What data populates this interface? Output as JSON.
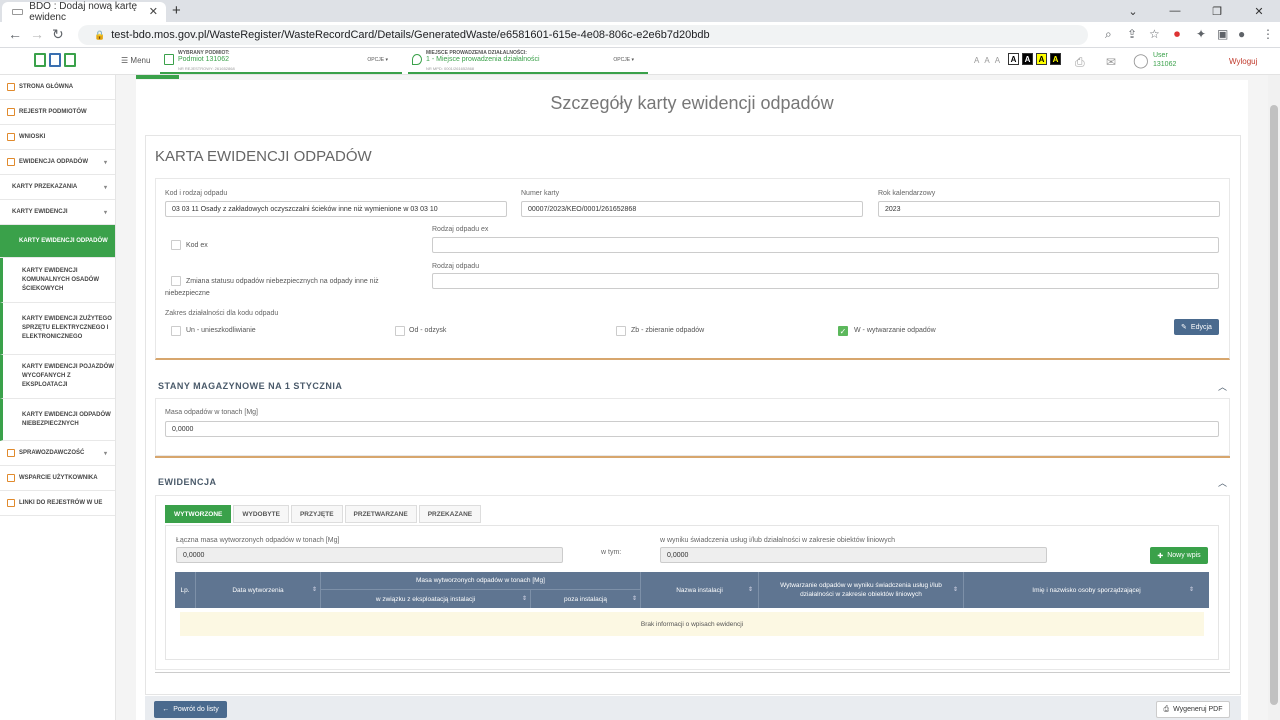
{
  "browser": {
    "tab_title": "BDO : Dodaj nową kartę ewidenc",
    "url": "test-bdo.mos.gov.pl/WasteRegister/WasteRecordCard/Details/GeneratedWaste/e6581601-615e-4e08-806c-e2e6b7d20bdb"
  },
  "header": {
    "menu_label": "Menu",
    "ctx1_label": "WYBRANY PODMIOT:",
    "ctx1_value": "Podmiot 131062",
    "ctx1_sub": "NR REJESTROWY: 261652868",
    "ctx1_opt": "OPCJE",
    "ctx2_label": "MIEJSCE PROWADZENIA DZIAŁALNOŚCI:",
    "ctx2_value": "1 - Miejsce prowadzenia działalności",
    "ctx2_sub": "NR MPD: 0001/261652868",
    "ctx2_opt": "OPCJE",
    "font_sizes": [
      "A",
      "A",
      "A"
    ],
    "contrast": [
      "A",
      "A",
      "A",
      "A"
    ],
    "user_line1": "User",
    "user_line2": "131062",
    "logout": "Wyloguj"
  },
  "sidebar": {
    "items": [
      {
        "label": "STRONA GŁÓWNA"
      },
      {
        "label": "REJESTR PODMIOTÓW"
      },
      {
        "label": "WNIOSKI"
      },
      {
        "label": "EWIDENCJA ODPADÓW"
      },
      {
        "label": "KARTY PRZEKAZANIA"
      },
      {
        "label": "KARTY EWIDENCJI"
      },
      {
        "label": "KARTY EWIDENCJI ODPADÓW"
      },
      {
        "label": "KARTY EWIDENCJI KOMUNALNYCH OSADÓW ŚCIEKOWYCH"
      },
      {
        "label": "KARTY EWIDENCJI ZUŻYTEGO SPRZĘTU ELEKTRYCZNEGO I ELEKTRONICZNEGO"
      },
      {
        "label": "KARTY EWIDENCJI POJAZDÓW WYCOFANYCH Z EKSPLOATACJI"
      },
      {
        "label": "KARTY EWIDENCJI ODPADÓW NIEBEZPIECZNYCH"
      },
      {
        "label": "SPRAWOZDAWCZOŚĆ"
      },
      {
        "label": "WSPARCIE UŻYTKOWNIKA"
      },
      {
        "label": "LINKI DO REJESTRÓW W UE"
      }
    ]
  },
  "main": {
    "page_title": "Szczegóły karty ewidencji odpadów",
    "card_title": "KARTA EWIDENCJI ODPADÓW",
    "waste_code_label": "Kod i rodzaj odpadu",
    "waste_code_value": "03 03 11 Osady z zakładowych oczyszczalni ścieków inne niż wymienione w 03 03 10",
    "card_number_label": "Numer karty",
    "card_number_value": "00007/2023/KEO/0001/261652868",
    "year_label": "Rok kalendarzowy",
    "year_value": "2023",
    "kod_ex_label": "Kod ex",
    "rodzaj_ex_label": "Rodzaj odpadu ex",
    "status_change_label_1": "Zmiana statusu odpadów niebezpiecznych na odpady inne niż",
    "status_change_label_2": "niebezpieczne",
    "rodzaj_label": "Rodzaj odpadu",
    "scope_label": "Zakres działalności dla kodu odpadu",
    "scope": [
      {
        "label": "Un - unieszkodliwianie",
        "checked": false
      },
      {
        "label": "Od - odzysk",
        "checked": false
      },
      {
        "label": "Zb - zbieranie odpadów",
        "checked": false
      },
      {
        "label": "W - wytwarzanie odpadów",
        "checked": true
      }
    ],
    "edit_button": "Edycja",
    "stock_header": "STANY MAGAZYNOWE NA 1 STYCZNIA",
    "stock_mass_label": "Masa odpadów w tonach [Mg]",
    "stock_mass_value": "0,0000",
    "ev_header": "EWIDENCJA",
    "tabs": [
      "WYTWORZONE",
      "WYDOBYTE",
      "PRZYJĘTE",
      "PRZETWARZANE",
      "PRZEKAZANE"
    ],
    "total_mass_label": "Łączna masa wytworzonych odpadów w tonach [Mg]",
    "total_mass_value": "0,0000",
    "wtym_label": "w tym:",
    "linear_label": "w wyniku świadczenia usług i/lub działalności w zakresie obiektów liniowych",
    "linear_value": "0,0000",
    "new_entry_button": "Nowy wpis",
    "table": {
      "col_lp": "Lp.",
      "col_date": "Data wytworzenia",
      "col_mass": "Masa wytworzonych odpadów w tonach [Mg]",
      "col_mass_a": "w związku z eksploatacją instalacji",
      "col_mass_b": "poza instalacją",
      "col_install": "Nazwa instalacji",
      "col_linear": "Wytwarzanie odpadów w wyniku świadczenia usług i/lub działalności w zakresie obiektów liniowych",
      "col_person": "Imię i nazwisko osoby sporządzającej",
      "empty_text": "Brak informacji o wpisach ewidencji"
    },
    "back_button": "Powrót do listy",
    "pdf_button": "Wygeneruj PDF"
  },
  "colors": {
    "accent": "#3aa14a",
    "header_table": "#5f7591",
    "button_blue": "#4a6a8e"
  }
}
